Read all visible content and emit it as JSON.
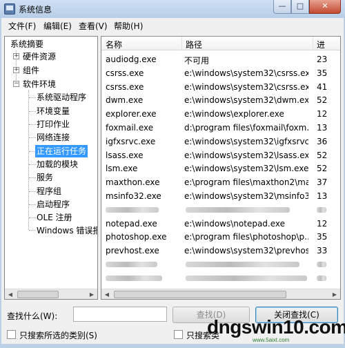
{
  "window": {
    "title": "系统信息",
    "controls": {
      "minimize": "—",
      "maximize": "□",
      "close": "✕"
    }
  },
  "menu": [
    {
      "label": "文件(F)"
    },
    {
      "label": "编辑(E)"
    },
    {
      "label": "查看(V)"
    },
    {
      "label": "帮助(H)"
    }
  ],
  "tree": {
    "root": "系统摘要",
    "nodes": [
      {
        "label": "硬件资源",
        "expander": "+"
      },
      {
        "label": "组件",
        "expander": "+"
      },
      {
        "label": "软件环境",
        "expander": "−"
      }
    ],
    "children": [
      {
        "label": "系统驱动程序"
      },
      {
        "label": "环境变量"
      },
      {
        "label": "打印作业"
      },
      {
        "label": "网络连接"
      },
      {
        "label": "正在运行任务",
        "selected": true
      },
      {
        "label": "加载的模块"
      },
      {
        "label": "服务"
      },
      {
        "label": "程序组"
      },
      {
        "label": "启动程序"
      },
      {
        "label": "OLE 注册"
      },
      {
        "label": "Windows 错误报"
      }
    ]
  },
  "list": {
    "columns": [
      "名称",
      "路径",
      "进"
    ],
    "rows": [
      {
        "name": "audiodg.exe",
        "path": "不可用",
        "pid": "23"
      },
      {
        "name": "csrss.exe",
        "path": "e:\\windows\\system32\\csrss.exe",
        "pid": "35"
      },
      {
        "name": "csrss.exe",
        "path": "e:\\windows\\system32\\csrss.exe",
        "pid": "41"
      },
      {
        "name": "dwm.exe",
        "path": "e:\\windows\\system32\\dwm.exe",
        "pid": "52"
      },
      {
        "name": "explorer.exe",
        "path": "e:\\windows\\explorer.exe",
        "pid": "12"
      },
      {
        "name": "foxmail.exe",
        "path": "d:\\program files\\foxmail\\foxm...",
        "pid": "13"
      },
      {
        "name": "igfxsrvc.exe",
        "path": "e:\\windows\\system32\\igfxsrvc....",
        "pid": "36"
      },
      {
        "name": "lsass.exe",
        "path": "e:\\windows\\system32\\lsass.exe",
        "pid": "52"
      },
      {
        "name": "lsm.exe",
        "path": "e:\\windows\\system32\\lsm.exe",
        "pid": "52"
      },
      {
        "name": "maxthon.exe",
        "path": "e:\\program files\\maxthon2\\ma...",
        "pid": "37"
      },
      {
        "name": "msinfo32.exe",
        "path": "e:\\windows\\system32\\msinfo3...",
        "pid": "13"
      },
      {
        "name": "",
        "path": "",
        "pid": "",
        "obscured": true
      },
      {
        "name": "notepad.exe",
        "path": "e:\\windows\\notepad.exe",
        "pid": "12"
      },
      {
        "name": "photoshop.exe",
        "path": "e:\\program files\\photoshop\\p...",
        "pid": "35"
      },
      {
        "name": "prevhost.exe",
        "path": "e:\\windows\\system32\\prevhos...",
        "pid": "33"
      },
      {
        "name": "",
        "path": "",
        "pid": "",
        "obscured": true
      },
      {
        "name": "",
        "path": "",
        "pid": "",
        "obscured": true
      },
      {
        "name": "",
        "path": "",
        "pid": "",
        "obscured": true
      }
    ]
  },
  "bottom": {
    "find_label": "查找什么(W):",
    "find_value": "",
    "find_button": "查找(D)",
    "close_find_button": "关闭查找(C)",
    "search_selected_label": "只搜索所选的类别(S)",
    "search_names_label": "只搜索类"
  },
  "watermark": {
    "text": "dngswin10.com",
    "sub": "www.5aixt.com"
  }
}
